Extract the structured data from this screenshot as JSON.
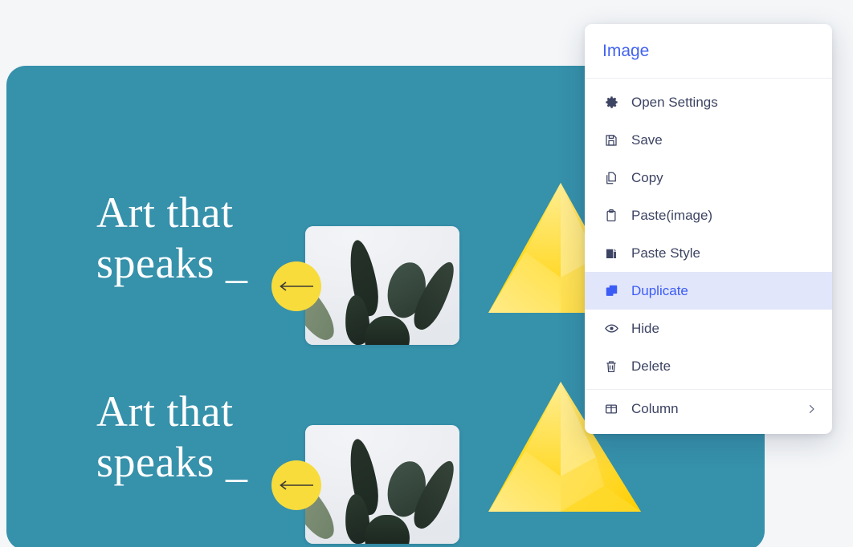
{
  "canvas": {
    "background_color": "#3691ab",
    "blocks": [
      {
        "headline": "Art that\nspeaks _",
        "arrow_icon": "arrow-left-icon",
        "badge_color": "#f7dc3c",
        "image_alt": "rubber-plant-photo",
        "shape": "yellow-pyramid"
      },
      {
        "headline": "Art that\nspeaks _",
        "arrow_icon": "arrow-left-icon",
        "badge_color": "#f7dc3c",
        "image_alt": "rubber-plant-photo",
        "shape": "yellow-pyramid"
      }
    ]
  },
  "context_menu": {
    "title": "Image",
    "title_color": "#4263f0",
    "highlight_color": "#e2e6fb",
    "highlight_text_color": "#3b5cf5",
    "items": [
      {
        "label": "Open Settings",
        "icon": "gear-icon",
        "active": false,
        "submenu": false
      },
      {
        "label": "Save",
        "icon": "save-floppy-icon",
        "active": false,
        "submenu": false
      },
      {
        "label": "Copy",
        "icon": "copy-icon",
        "active": false,
        "submenu": false
      },
      {
        "label": "Paste(image)",
        "icon": "clipboard-icon",
        "active": false,
        "submenu": false
      },
      {
        "label": "Paste Style",
        "icon": "paste-style-icon",
        "active": false,
        "submenu": false
      },
      {
        "label": "Duplicate",
        "icon": "duplicate-icon",
        "active": true,
        "submenu": false
      },
      {
        "label": "Hide",
        "icon": "eye-icon",
        "active": false,
        "submenu": false
      },
      {
        "label": "Delete",
        "icon": "trash-icon",
        "active": false,
        "submenu": false
      },
      {
        "label": "Column",
        "icon": "columns-icon",
        "active": false,
        "submenu": true,
        "chevron": "chevron-right-icon"
      }
    ]
  }
}
